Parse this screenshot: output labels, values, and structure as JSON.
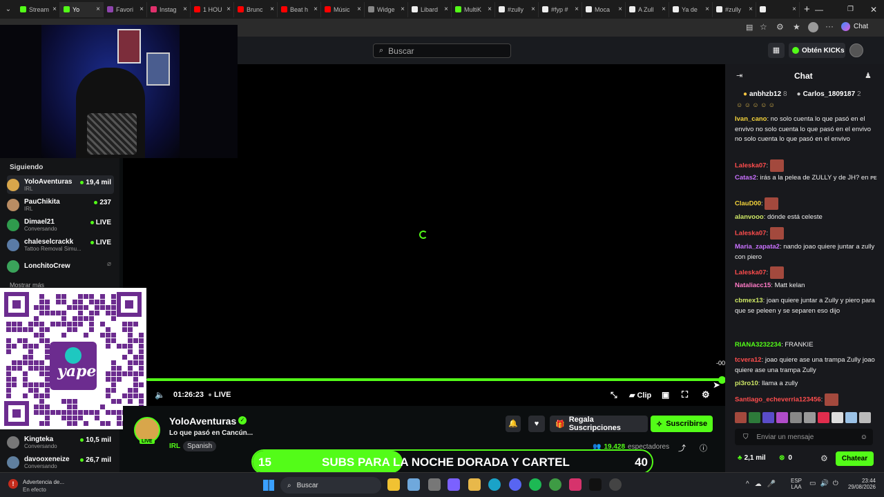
{
  "browser": {
    "tabs": [
      {
        "label": "Stream",
        "color": "#53fc18"
      },
      {
        "label": "Yo",
        "color": "#53fc18",
        "active": true
      },
      {
        "label": "Favori",
        "color": "#8e44ad"
      },
      {
        "label": "Instag",
        "color": "#e1306c"
      },
      {
        "label": "1 HOU",
        "color": "#ff0000"
      },
      {
        "label": "Brunc",
        "color": "#ff0000"
      },
      {
        "label": "Beat h",
        "color": "#ff0000"
      },
      {
        "label": "Músic",
        "color": "#ff0000"
      },
      {
        "label": "Widge",
        "color": "#888888"
      },
      {
        "label": "Libard",
        "color": "#eeeeee"
      },
      {
        "label": "MultiK",
        "color": "#53fc18"
      },
      {
        "label": "#zully",
        "color": "#eeeeee"
      },
      {
        "label": "#fyp #",
        "color": "#eeeeee"
      },
      {
        "label": "Moca",
        "color": "#eeeeee"
      },
      {
        "label": "A Zull",
        "color": "#eeeeee"
      },
      {
        "label": "Ya de",
        "color": "#eeeeee"
      },
      {
        "label": "#zully",
        "color": "#eeeeee"
      },
      {
        "label": "",
        "color": "#eeeeee"
      }
    ],
    "chat_button": "Chat"
  },
  "header": {
    "search_placeholder": "Buscar",
    "get_kicks": "Obtén KICKs"
  },
  "player": {
    "time": "01:26:23",
    "live": "LIVE",
    "clip": "Clip",
    "timeline_end": "-00"
  },
  "sidebar": {
    "following_title": "Siguiendo",
    "show_more": "Mostrar más",
    "items": [
      {
        "name": "YoloAventuras",
        "category": "IRL",
        "viewers": "19,4 mil",
        "color": "#d8a64b"
      },
      {
        "name": "PauChikita",
        "category": "IRL",
        "viewers": "237",
        "color": "#b98c63"
      },
      {
        "name": "Dimael21",
        "category": "Conversando",
        "viewers": "LIVE",
        "color": "#2f9b4d"
      },
      {
        "name": "chaleselcrackk",
        "category": "Tattoo Removal Simu...",
        "viewers": "LIVE",
        "color": "#5a7ba6"
      },
      {
        "name": "LonchitoCrew",
        "category": "",
        "viewers": "",
        "color": "#3aa35a"
      },
      {
        "name": "Kingteka",
        "category": "Conversando",
        "viewers": "10,5 mil",
        "color": "#777777"
      },
      {
        "name": "davooxeneize",
        "category": "Conversando",
        "viewers": "26,7 mil",
        "color": "#5f7f9f"
      }
    ]
  },
  "qr": {
    "brand": "yape"
  },
  "stream": {
    "channel": "YoloAventuras",
    "title": "Lo que pasó en Cancún...",
    "category": "IRL",
    "language": "Spanish",
    "live_badge": "LIVE",
    "viewers": "19.428",
    "viewers_label": "espectadores",
    "gift_subs": "Regala Suscripciones",
    "subscribe": "Suscribirse"
  },
  "banner": {
    "left": "15",
    "text": "SUBS PARA LA NOCHE DORADA Y CARTEL",
    "right": "40",
    "progress": 0.375
  },
  "chat": {
    "title": "Chat",
    "top_gifters": [
      {
        "name": "anbhzb12",
        "count": "8"
      },
      {
        "name": "Carlos_1809187",
        "count": "2"
      }
    ],
    "messages": [
      {
        "user": "Ivan_cano",
        "color": "#f5d43b",
        "text": "no solo cuenta lo que pasó en el envivo no solo cuenta lo que pasó en el envivo no solo cuenta lo que pasó en el envivo"
      },
      {
        "user": "Laleska07",
        "color": "#ff4d4d",
        "text": ""
      },
      {
        "user": "Catas2",
        "color": "#c971ff",
        "text": "irás a la pelea de ZULLY y de JH? en ᴘᴇ"
      },
      {
        "user": "ClauD00",
        "color": "#f5d43b",
        "text": ""
      },
      {
        "user": "alanvooo",
        "color": "#cfe866",
        "text": "dónde está celeste"
      },
      {
        "user": "Laleska07",
        "color": "#ff4d4d",
        "text": ""
      },
      {
        "user": "Maria_zapata2",
        "color": "#c971ff",
        "text": "nando joao quiere juntar a zully con piero"
      },
      {
        "user": "Laleska07",
        "color": "#ff4d4d",
        "text": ""
      },
      {
        "user": "Nataliacc15",
        "color": "#ff7ac6",
        "text": "Matt kelan"
      },
      {
        "user": "cbmex13",
        "color": "#cfe866",
        "text": "joan quiere juntar a Zully y piero para que se peleen y se separen eso dijo"
      },
      {
        "user": "RIANA3232234",
        "color": "#53fc18",
        "text": "FRANKIE"
      },
      {
        "user": "tcvera12",
        "color": "#ff4d4d",
        "text": "joao quiere ase una trampa Zully joao quiere ase una trampa Zully"
      },
      {
        "user": "pi3ro10",
        "color": "#cfe866",
        "text": "llama a zully"
      },
      {
        "user": "Santiago_echeverria123456",
        "color": "#ff4d4d",
        "text": ""
      }
    ],
    "input_placeholder": "Enviar un mensaje",
    "kicks": "2,1 mil",
    "points": "0",
    "send": "Chatear"
  },
  "taskbar": {
    "warning_title": "Advertencia de...",
    "warning_sub": "En efecto",
    "search": "Buscar",
    "lang": "ESP",
    "lang_sub": "LAA",
    "time": "23:44",
    "date": "29/08/2026"
  }
}
